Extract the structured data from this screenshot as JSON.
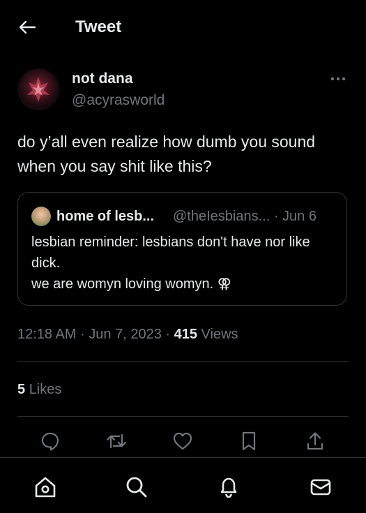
{
  "header": {
    "title": "Tweet",
    "back_icon": "arrow-left-icon"
  },
  "tweet": {
    "author_name": "not dana",
    "author_handle": "@acyrasworld",
    "text": "do y’all even realize how dumb you sound when you say shit like this?",
    "quote": {
      "author_name": "home of lesb...",
      "author_handle": "@theIesbians... · Jun 6",
      "text": "lesbian reminder: lesbians don't have nor like dick.\nwe are womyn loving womyn. ⚢"
    },
    "time": "12:18 AM",
    "date": "Jun 7, 2023",
    "views_count": "415",
    "views_label": "Views",
    "likes_count": "5",
    "likes_label": "Likes"
  },
  "actions": [
    "reply-icon",
    "retweet-icon",
    "like-icon",
    "bookmark-icon",
    "share-icon"
  ],
  "bottom_nav": [
    "home-icon",
    "search-icon",
    "notifications-icon",
    "messages-icon"
  ],
  "colors": {
    "background": "#000000",
    "text": "#e7e9ea",
    "secondary_text": "#71767b",
    "border": "#2f3336"
  }
}
